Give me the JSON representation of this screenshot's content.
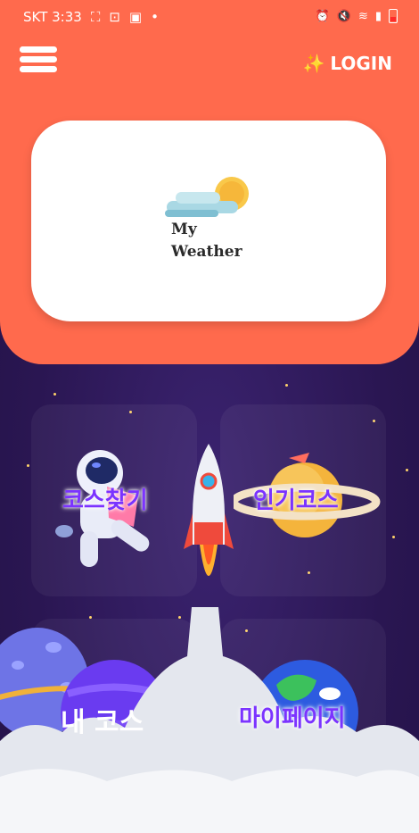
{
  "statusbar": {
    "carrier_time": "SKT 3:33"
  },
  "header": {
    "login_label": "LOGIN",
    "sparkle": "✨"
  },
  "weather_card": {
    "line1": "My",
    "line2": "Weather"
  },
  "tiles": {
    "find_course": "코스찾기",
    "popular_course": "인기코스",
    "my_course": "내 코스",
    "my_page": "마이페이지"
  },
  "colors": {
    "header": "#ff6a4d",
    "background": "#2f1b5a",
    "label": "#7b33ff"
  }
}
